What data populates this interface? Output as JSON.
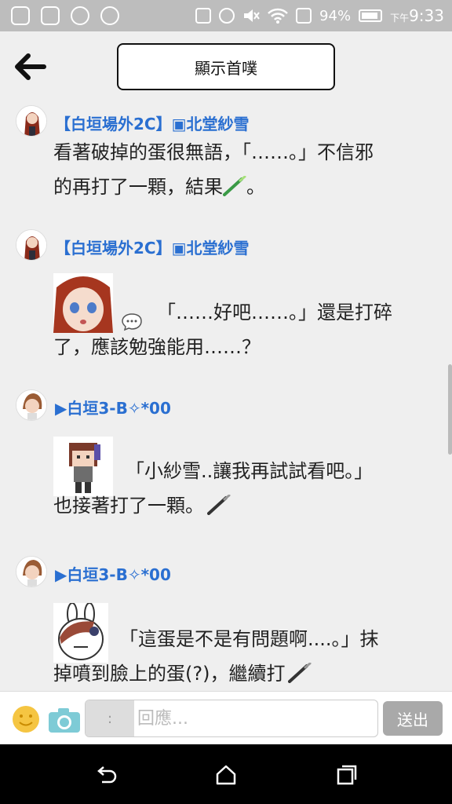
{
  "status": {
    "battery_pct": "94%",
    "time_prefix": "下午",
    "time": "9:33"
  },
  "header": {
    "title": "顯示首噗"
  },
  "posts": [
    {
      "author": "【白垣場外2C】",
      "author_badge": "▣北堂紗雪",
      "lines": [
        "看著破掉的蛋很無語，「……。」不信邪",
        "的再打了一顆，結果"
      ],
      "trailing": "。"
    },
    {
      "author": "【白垣場外2C】",
      "author_badge": "▣北堂紗雪",
      "lines": [
        "「……好吧……。」還是打碎",
        "了，應該勉強能用……？"
      ]
    },
    {
      "author": "▶白垣3-B✧*00",
      "lines": [
        "「小紗雪..讓我再試試看吧。」",
        "也接著打了一顆。"
      ]
    },
    {
      "author": "▶白垣3-B✧*00",
      "lines": [
        "「這蛋是不是有問題啊....。」抹",
        "掉噴到臉上的蛋(?)，繼續打"
      ]
    }
  ],
  "reply": {
    "prefix": ":",
    "placeholder": "回應...",
    "send_label": "送出"
  },
  "colors": {
    "author": "#2a6fd1",
    "statusbar": "#bdbdbd",
    "send": "#a9a9a9"
  }
}
